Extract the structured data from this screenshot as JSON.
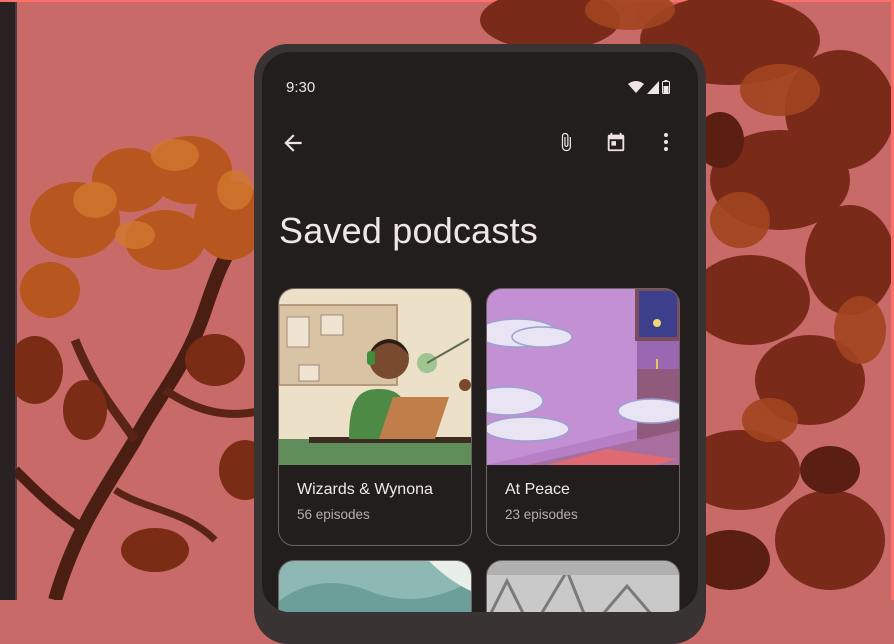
{
  "status_bar": {
    "time": "9:30",
    "icons": [
      "wifi-icon",
      "signal-icon",
      "battery-icon"
    ]
  },
  "app_bar": {
    "back_icon": "arrow-back-icon",
    "actions": [
      "paperclip-icon",
      "calendar-icon",
      "more-vert-icon"
    ]
  },
  "page": {
    "title": "Saved podcasts"
  },
  "podcasts": [
    {
      "name": "Wizards & Wynona",
      "episodes": "56 episodes",
      "art": "person-recording-podcast-illustration"
    },
    {
      "name": "At Peace",
      "episodes": "23 episodes",
      "art": "pink-room-with-clouds-illustration"
    }
  ],
  "colors": {
    "background": "#c86a68",
    "screen": "#231e1e",
    "text_primary": "#f2e8e7",
    "text_secondary": "#b9adac",
    "card_border": "#6f6362"
  }
}
